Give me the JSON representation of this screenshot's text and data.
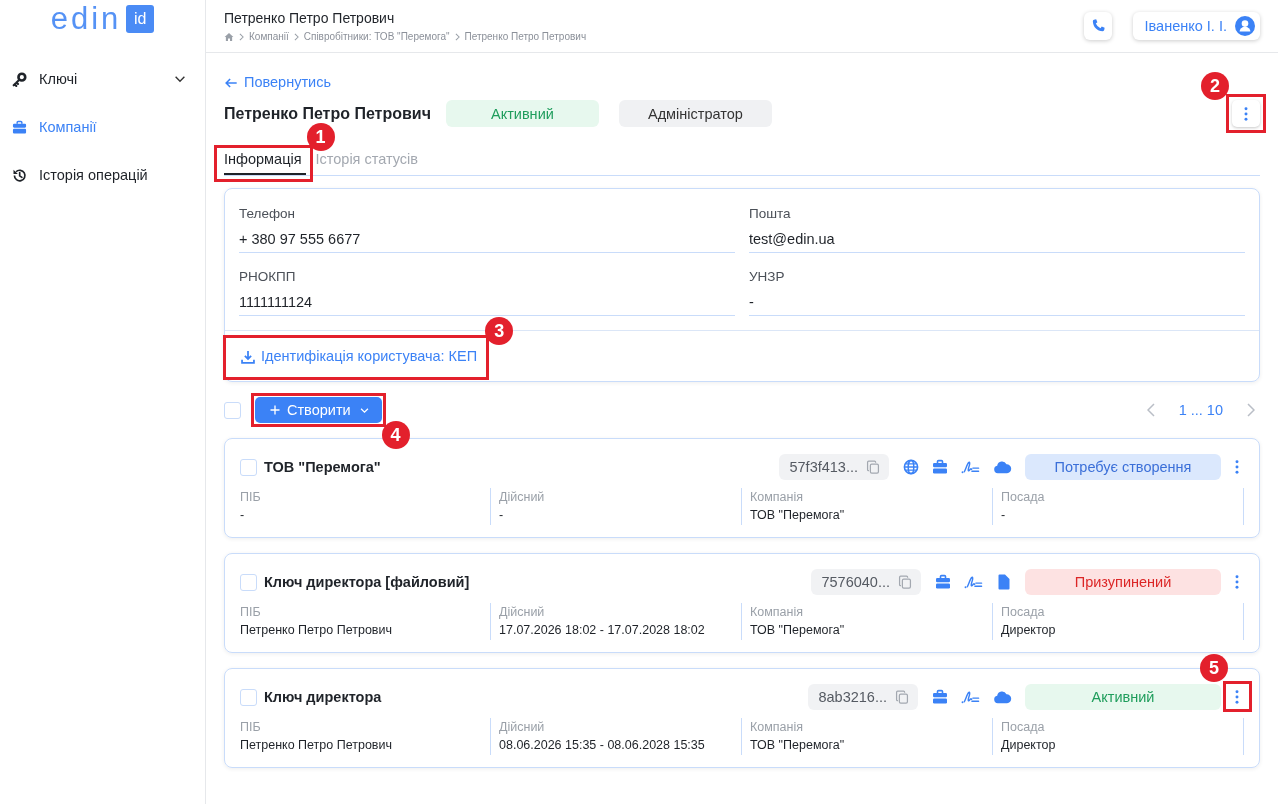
{
  "sidebar": {
    "logo": {
      "wordmark": "edin",
      "badge": "id"
    },
    "items": [
      {
        "label": "Ключі",
        "kind": "group",
        "expanded": false,
        "selected": false
      },
      {
        "label": "Компанії",
        "kind": "link",
        "selected": true
      },
      {
        "label": "Історія операцій",
        "kind": "link",
        "selected": false
      }
    ]
  },
  "header": {
    "title": "Петренко Петро Петрович",
    "breadcrumbs": [
      "Компанії",
      "Співробітники: ТОВ \"Перемога\"",
      "Петренко Петро Петрович"
    ],
    "user": "Іваненко І. І."
  },
  "page": {
    "back_link": "Повернутись",
    "name": "Петренко Петро Петрович",
    "status": {
      "label": "Активний",
      "kind": "active"
    },
    "role": "Адміністратор",
    "more_callout": "2",
    "tabs": [
      {
        "label": "Інформація",
        "selected": true,
        "callout": "1"
      },
      {
        "label": "Історія статусів",
        "selected": false
      }
    ]
  },
  "info": {
    "fields": [
      {
        "label": "Телефон",
        "value": "+ 380 97 555 6677"
      },
      {
        "label": "Пошта",
        "value": "test@edin.ua"
      },
      {
        "label": "РНОКПП",
        "value": "1111111124"
      },
      {
        "label": "УНЗР",
        "value": "-"
      }
    ],
    "link": {
      "label": "Ідентифікація користувача: КЕП",
      "callout": "3"
    }
  },
  "toolbar": {
    "select_all": {
      "checked": false
    },
    "create_button": {
      "label": "Створити",
      "callout": "4"
    },
    "pagination": {
      "label": "1 ... 10"
    }
  },
  "cards": [
    {
      "checked": false,
      "title": "ТОВ \"Перемога\"",
      "key_id": "57f3f413...",
      "features": [
        {
          "kind": "web"
        },
        {
          "kind": "company"
        },
        {
          "kind": "signature"
        },
        {
          "kind": "cloud"
        }
      ],
      "status": {
        "label": "Потребує створення",
        "kind": "pending"
      },
      "columns": [
        {
          "label": "ПІБ",
          "value": "-"
        },
        {
          "label": "Дійсний",
          "value": "-"
        },
        {
          "label": "Компанія",
          "value": "ТОВ \"Перемога\""
        },
        {
          "label": "Посада",
          "value": "-"
        }
      ]
    },
    {
      "checked": false,
      "title": "Ключ директора [файловий]",
      "key_id": "7576040...",
      "features": [
        {
          "kind": "company"
        },
        {
          "kind": "signature"
        },
        {
          "kind": "file"
        }
      ],
      "status": {
        "label": "Призупинений",
        "kind": "suspended"
      },
      "columns": [
        {
          "label": "ПІБ",
          "value": "Петренко Петро Петрович"
        },
        {
          "label": "Дійсний",
          "value": "17.07.2026 18:02 - 17.07.2028 18:02"
        },
        {
          "label": "Компанія",
          "value": "ТОВ \"Перемога\""
        },
        {
          "label": "Посада",
          "value": "Директор"
        }
      ]
    },
    {
      "checked": false,
      "title": "Ключ директора",
      "key_id": "8ab3216...",
      "features": [
        {
          "kind": "company"
        },
        {
          "kind": "signature"
        },
        {
          "kind": "cloud"
        }
      ],
      "status": {
        "label": "Активний",
        "kind": "active"
      },
      "menu_callout": "5",
      "columns": [
        {
          "label": "ПІБ",
          "value": "Петренко Петро Петрович"
        },
        {
          "label": "Дійсний",
          "value": "08.06.2026 15:35 - 08.06.2028 15:35"
        },
        {
          "label": "Компанія",
          "value": "ТОВ \"Перемога\""
        },
        {
          "label": "Посада",
          "value": "Директор"
        }
      ]
    }
  ]
}
